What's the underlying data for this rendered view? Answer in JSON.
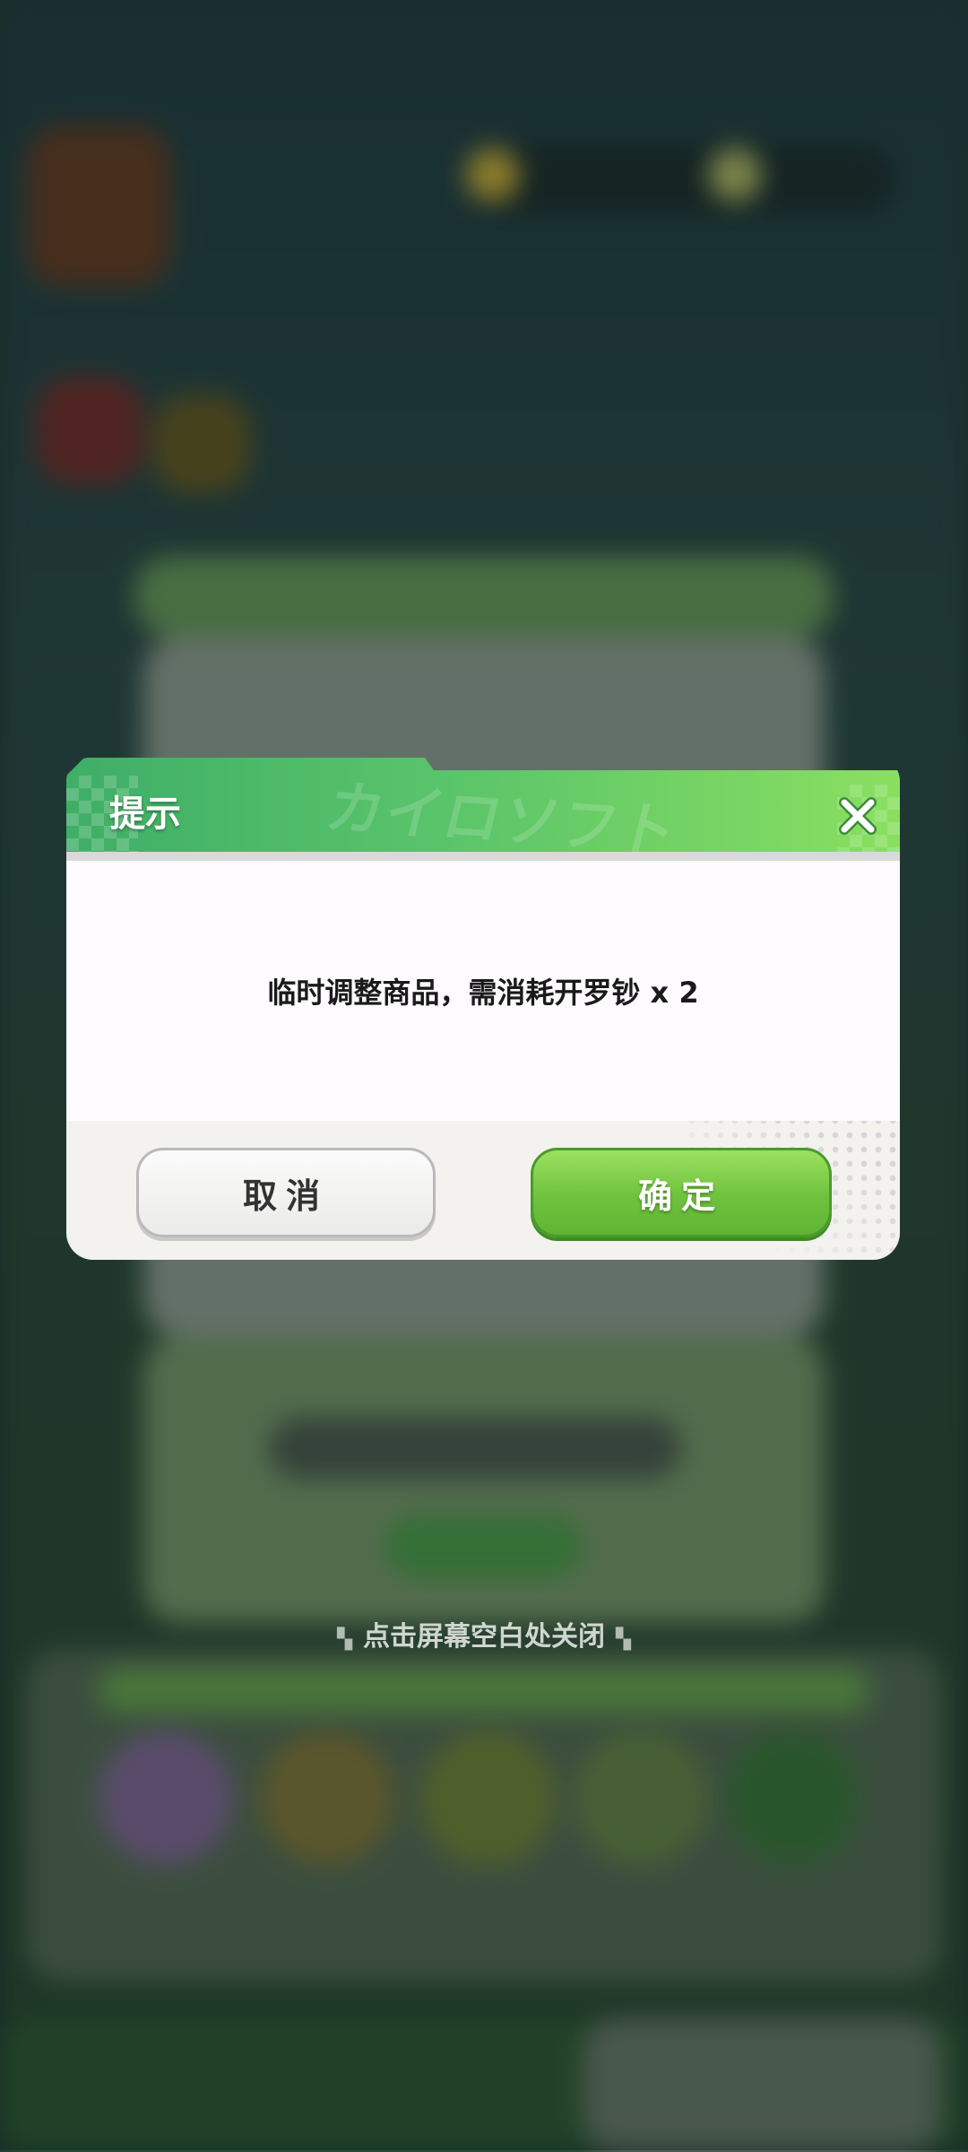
{
  "dialog": {
    "title": "提示",
    "watermark": "カイロソフト",
    "message": "临时调整商品，需消耗开罗钞 x 2",
    "cancel_label": "取消",
    "confirm_label": "确定",
    "close_icon": "close-icon"
  },
  "hint": {
    "text": "点击屏幕空白处关闭",
    "deco_left": "▚",
    "deco_right": "▚"
  },
  "colors": {
    "header_start": "#3fae67",
    "header_end": "#8adf60",
    "confirm_green": "#6fc23d",
    "body_bg": "#fdfbfd",
    "footer_bg": "#f3f2ee"
  }
}
